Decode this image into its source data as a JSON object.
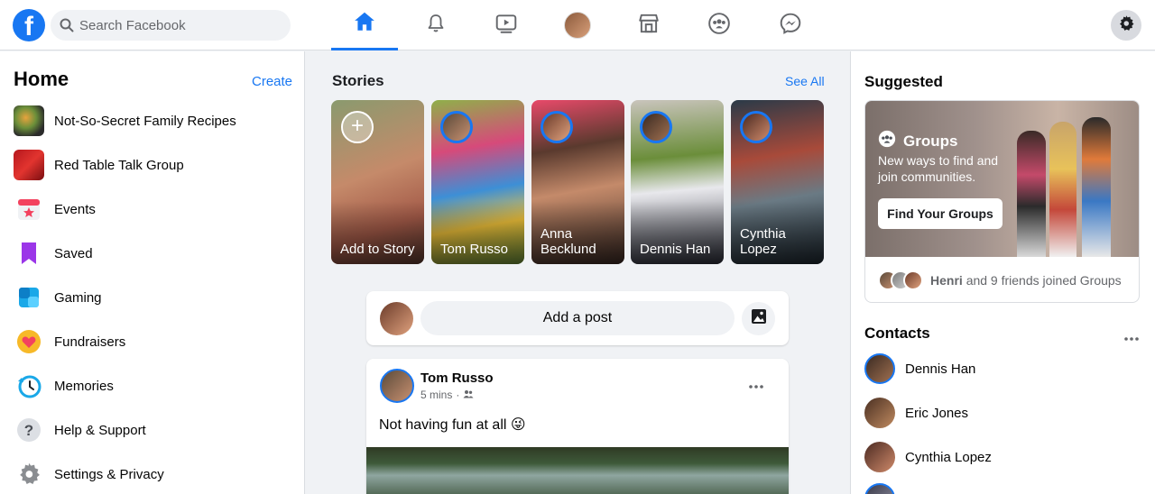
{
  "header": {
    "logo": "f",
    "search_placeholder": "Search Facebook",
    "nav": [
      "home-icon",
      "bell-icon",
      "watch-icon",
      "profile-avatar",
      "marketplace-icon",
      "groups-icon",
      "messenger-icon"
    ],
    "accent_color": "#1877f2"
  },
  "sidebar": {
    "title": "Home",
    "create_label": "Create",
    "items": [
      {
        "label": "Not-So-Secret Family Recipes",
        "icon": "group-thumbnail"
      },
      {
        "label": "Red Table Talk Group",
        "icon": "group-thumbnail"
      },
      {
        "label": "Events",
        "icon": "calendar-star-icon"
      },
      {
        "label": "Saved",
        "icon": "bookmark-icon"
      },
      {
        "label": "Gaming",
        "icon": "gaming-icon"
      },
      {
        "label": "Fundraisers",
        "icon": "heart-icon"
      },
      {
        "label": "Memories",
        "icon": "clock-icon"
      },
      {
        "label": "Help & Support",
        "icon": "question-icon"
      },
      {
        "label": "Settings & Privacy",
        "icon": "gear-icon"
      }
    ]
  },
  "stories": {
    "title": "Stories",
    "see_all": "See All",
    "plus": "+",
    "items": [
      {
        "name": "Add to Story"
      },
      {
        "name": "Tom Russo"
      },
      {
        "name": "Anna Becklund"
      },
      {
        "name": "Dennis Han"
      },
      {
        "name": "Cynthia Lopez"
      }
    ]
  },
  "composer": {
    "prompt": "Add a post"
  },
  "post": {
    "author": "Tom Russo",
    "time": "5 mins",
    "separator": "·",
    "text": "Not having fun at all 😜"
  },
  "right": {
    "suggested_title": "Suggested",
    "groups_label": "Groups",
    "groups_desc": "New ways to find and join communities.",
    "find_button": "Find Your Groups",
    "joined_name": "Henri",
    "joined_rest": "and 9 friends joined Groups",
    "contacts_title": "Contacts",
    "contacts": [
      {
        "name": "Dennis Han"
      },
      {
        "name": "Eric Jones"
      },
      {
        "name": "Cynthia Lopez"
      }
    ]
  }
}
